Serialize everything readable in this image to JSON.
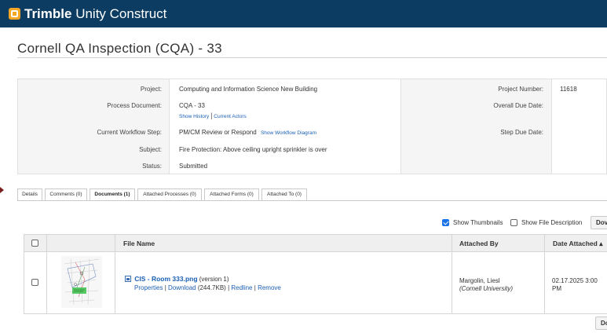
{
  "app": {
    "brand_bold": "Trimble",
    "brand_light": " Unity Construct"
  },
  "page": {
    "title": "Cornell QA Inspection (CQA) - 33"
  },
  "details": {
    "project_label": "Project:",
    "project_value": "Computing and Information Science New Building",
    "process_document_label": "Process Document:",
    "process_document_value": "CQA - 33",
    "show_history": "Show History",
    "link_separator": "|",
    "current_actors": "Current Actors",
    "workflow_step_label": "Current Workflow Step:",
    "workflow_step_value": "PM/CM Review or Respond",
    "show_workflow_diagram": "Show Workflow Diagram",
    "subject_label": "Subject:",
    "subject_value": "Fire Protection: Above ceiling upright sprinkler is over",
    "status_label": "Status:",
    "status_value": "Submitted",
    "project_number_label": "Project Number:",
    "project_number_value": "11618",
    "overall_due_label": "Overall Due Date:",
    "step_due_label": "Step Due Date:"
  },
  "tabs": [
    {
      "label": "Details"
    },
    {
      "label": "Comments (0)"
    },
    {
      "label": "Documents (1)"
    },
    {
      "label": "Attached Processes (0)"
    },
    {
      "label": "Attached Forms (0)"
    },
    {
      "label": "Attached To (0)"
    }
  ],
  "options": {
    "show_thumbnails": "Show Thumbnails",
    "show_thumbnails_checked": true,
    "show_file_description": "Show File Description",
    "show_file_description_checked": false,
    "download_button_top": "Dov",
    "download_button_bottom": "Do"
  },
  "table": {
    "headers": {
      "file_name": "File Name",
      "attached_by": "Attached By",
      "date_attached": "Date Attached ▴"
    },
    "rows": [
      {
        "file_name": "CIS - Room 333.png",
        "version": " (version 1)",
        "action_properties": "Properties",
        "action_sep1": "|",
        "action_download": "Download",
        "download_size": " (244.7KB) ",
        "action_sep2": "|",
        "action_redline": "Redline",
        "action_sep3": "|",
        "action_remove": "Remove",
        "attached_by_name": "Margolin, Liesl",
        "attached_by_org": "(Cornell University)",
        "date_line1": "02.17.2025 3:00",
        "date_line2": "PM"
      }
    ]
  },
  "colors": {
    "topbar": "#0c3c61",
    "logo": "#f5a623",
    "link": "#1a5fb4",
    "checkbox_checked": "#1a73e8"
  },
  "icons": {
    "logo": "trimble-logo-icon",
    "file": "image-file-icon",
    "checkbox": "checkbox-icon"
  }
}
